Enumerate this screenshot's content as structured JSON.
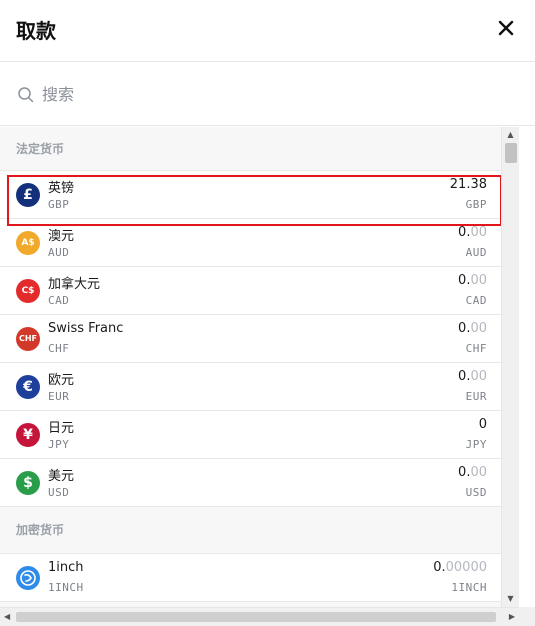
{
  "header": {
    "title": "取款"
  },
  "search": {
    "placeholder": "搜索"
  },
  "sections": [
    {
      "label": "法定货币",
      "items": [
        {
          "name": "英镑",
          "code": "GBP",
          "amount_int": "21.38",
          "amount_dec": "",
          "unit": "GBP",
          "icon": "pound-icon",
          "glyph": "£",
          "color": "#12317a"
        },
        {
          "name": "澳元",
          "code": "AUD",
          "amount_int": "0.",
          "amount_dec": "00",
          "unit": "AUD",
          "icon": "aud-icon",
          "glyph": "A$",
          "color": "#f0a92b"
        },
        {
          "name": "加拿大元",
          "code": "CAD",
          "amount_int": "0.",
          "amount_dec": "00",
          "unit": "CAD",
          "icon": "cad-icon",
          "glyph": "C$",
          "color": "#e42b2b"
        },
        {
          "name": "Swiss Franc",
          "code": "CHF",
          "amount_int": "0.",
          "amount_dec": "00",
          "unit": "CHF",
          "icon": "chf-icon",
          "glyph": "CHF",
          "color": "#d3392b"
        },
        {
          "name": "欧元",
          "code": "EUR",
          "amount_int": "0.",
          "amount_dec": "00",
          "unit": "EUR",
          "icon": "euro-icon",
          "glyph": "€",
          "color": "#1e3f9c"
        },
        {
          "name": "日元",
          "code": "JPY",
          "amount_int": "0",
          "amount_dec": "",
          "unit": "JPY",
          "icon": "yen-icon",
          "glyph": "¥",
          "color": "#c5153a"
        },
        {
          "name": "美元",
          "code": "USD",
          "amount_int": "0.",
          "amount_dec": "00",
          "unit": "USD",
          "icon": "dollar-icon",
          "glyph": "$",
          "color": "#2a9d4b"
        }
      ]
    },
    {
      "label": "加密货币",
      "items": [
        {
          "name": "1inch",
          "code": "1INCH",
          "amount_int": "0.",
          "amount_dec": "00000",
          "unit": "1INCH",
          "icon": "1inch-icon",
          "glyph": "",
          "color": "#2f8be8"
        }
      ]
    }
  ]
}
